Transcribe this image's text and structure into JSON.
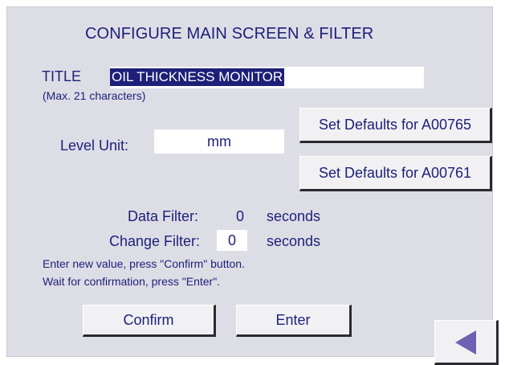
{
  "screen": {
    "title": "CONFIGURE MAIN SCREEN & FILTER"
  },
  "title_field": {
    "label": "TITLE",
    "value": "OIL THICKNESS MONITOR",
    "hint": "(Max. 21 characters)"
  },
  "level_unit": {
    "label": "Level Unit:",
    "value": "mm"
  },
  "defaults": {
    "a00765_label": "Set Defaults for A00765",
    "a00761_label": "Set Defaults for A00761"
  },
  "data_filter": {
    "label": "Data Filter:",
    "value": "0",
    "unit": "seconds"
  },
  "change_filter": {
    "label": "Change Filter:",
    "value": "0",
    "unit": "seconds"
  },
  "instructions": {
    "line1": "Enter new value, press \"Confirm\" button.",
    "line2": "Wait for confirmation,  press \"Enter\"."
  },
  "buttons": {
    "confirm_label": "Confirm",
    "enter_label": "Enter",
    "back_icon": "triangle-left-icon"
  },
  "colors": {
    "text": "#1d1f78",
    "panel": "#dddde6",
    "button_face": "#f1f1f4",
    "back_arrow": "#6e60b3"
  }
}
